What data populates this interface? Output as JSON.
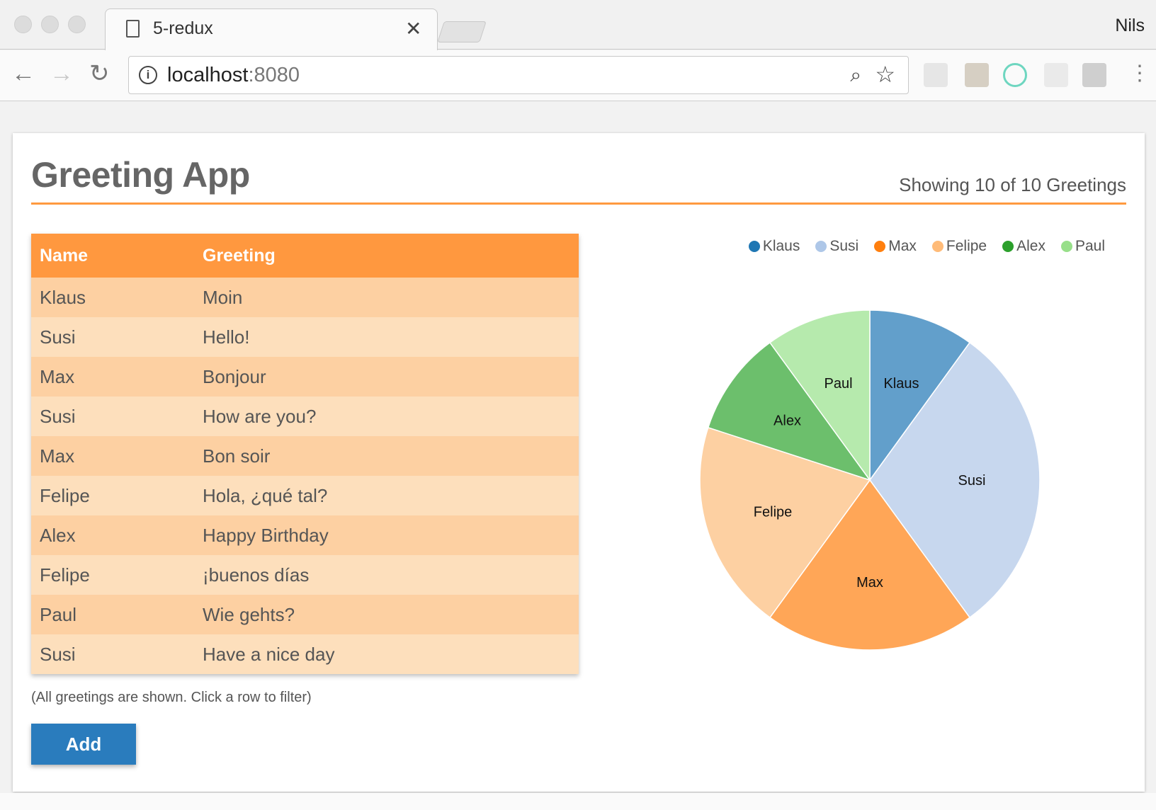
{
  "browser": {
    "tab_title": "5-redux",
    "user_name": "Nils",
    "url_host": "localhost",
    "url_port": ":8080"
  },
  "app": {
    "title": "Greeting App",
    "showing": "Showing 10 of 10 Greetings",
    "hint": "(All greetings are shown. Click a row to filter)",
    "add_label": "Add",
    "accent_color": "#ff983f",
    "button_color": "#2a7cbd"
  },
  "table": {
    "headers": [
      "Name",
      "Greeting"
    ],
    "rows": [
      [
        "Klaus",
        "Moin"
      ],
      [
        "Susi",
        "Hello!"
      ],
      [
        "Max",
        "Bonjour"
      ],
      [
        "Susi",
        "How are you?"
      ],
      [
        "Max",
        "Bon soir"
      ],
      [
        "Felipe",
        "Hola, ¿qué tal?"
      ],
      [
        "Alex",
        "Happy Birthday"
      ],
      [
        "Felipe",
        "¡buenos días"
      ],
      [
        "Paul",
        "Wie gehts?"
      ],
      [
        "Susi",
        "Have a nice day"
      ]
    ]
  },
  "chart_data": {
    "type": "pie",
    "categories": [
      "Klaus",
      "Susi",
      "Max",
      "Felipe",
      "Alex",
      "Paul"
    ],
    "values": [
      1,
      3,
      2,
      2,
      1,
      1
    ],
    "legend_colors": [
      "#1f77b4",
      "#aec7e8",
      "#ff7f0e",
      "#ffbb78",
      "#2ca02c",
      "#98df8a"
    ],
    "slice_colors": [
      "#629fcb",
      "#c7d7ee",
      "#ffa657",
      "#fdd0a2",
      "#6cbf6c",
      "#b6eaad"
    ],
    "legend_position": "top-right"
  }
}
